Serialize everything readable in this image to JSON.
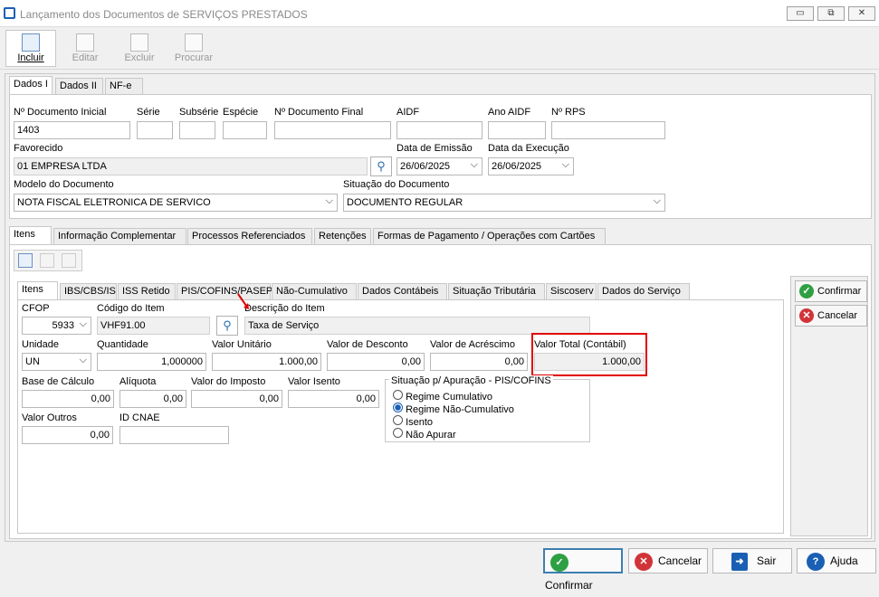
{
  "window": {
    "title": "Lançamento dos Documentos de SERVIÇOS PRESTADOS",
    "minimize": "▭",
    "restore": "⧉",
    "close": "✕"
  },
  "toolbar": {
    "incluir": "Incluir",
    "editar": "Editar",
    "excluir": "Excluir",
    "procurar": "Procurar"
  },
  "top_tabs": [
    "Dados I",
    "Dados II",
    "NF-e"
  ],
  "labels": {
    "doc_inicial": "Nº Documento Inicial",
    "serie": "Série",
    "subserie": "Subsérie",
    "especie": "Espécie",
    "doc_final": "Nº Documento Final",
    "aidf": "AIDF",
    "ano_aidf": "Ano AIDF",
    "rps": "Nº RPS",
    "favorecido": "Favorecido",
    "data_emissao": "Data de Emissão",
    "data_execucao": "Data da Execução",
    "modelo": "Modelo do Documento",
    "situacao": "Situação do Documento"
  },
  "values": {
    "doc_inicial": "1403",
    "favorecido": "01 EMPRESA LTDA",
    "data_emissao": "26/06/2025",
    "data_execucao": "26/06/2025",
    "modelo": "NOTA FISCAL ELETRONICA DE SERVICO",
    "situacao": "DOCUMENTO REGULAR"
  },
  "mid_tabs": [
    "Itens",
    "Informação Complementar",
    "Processos Referenciados",
    "Retenções",
    "Formas de Pagamento / Operações com Cartões"
  ],
  "item_tabs": [
    "Itens",
    "IBS/CBS/IS",
    "ISS Retido",
    "PIS/COFINS/PASEP",
    "Não-Cumulativo",
    "Dados Contábeis",
    "Situação Tributária",
    "Siscoserv",
    "Dados do Serviço"
  ],
  "item": {
    "cfop_label": "CFOP",
    "cfop": "5933",
    "codigo_label": "Código do Item",
    "codigo": "VHF91.00",
    "descricao_label": "Descrição do Item",
    "descricao": "Taxa de Serviço",
    "unidade_label": "Unidade",
    "unidade": "UN",
    "quantidade_label": "Quantidade",
    "quantidade": "1,000000",
    "valor_unitario_label": "Valor Unitário",
    "valor_unitario": "1.000,00",
    "valor_desconto_label": "Valor de Desconto",
    "valor_desconto": "0,00",
    "valor_acrescimo_label": "Valor de Acréscimo",
    "valor_acrescimo": "0,00",
    "valor_total_label": "Valor Total (Contábil)",
    "valor_total": "1.000,00",
    "base_calculo_label": "Base de Cálculo",
    "base_calculo": "0,00",
    "aliquota_label": "Alíquota",
    "aliquota": "0,00",
    "valor_imposto_label": "Valor do Imposto",
    "valor_imposto": "0,00",
    "valor_isento_label": "Valor Isento",
    "valor_isento": "0,00",
    "valor_outros_label": "Valor Outros",
    "valor_outros": "0,00",
    "id_cnae_label": "ID CNAE",
    "id_cnae": ""
  },
  "situacao_apuracao": {
    "title": "Situação p/ Apuração - PIS/COFINS",
    "options": [
      "Regime Cumulativo",
      "Regime Não-Cumulativo",
      "Isento",
      "Não Apurar"
    ],
    "selected": 1
  },
  "side_buttons": {
    "confirmar": "Confirmar",
    "cancelar": "Cancelar"
  },
  "bottom_buttons": {
    "confirmar": "Confirmar",
    "cancelar": "Cancelar",
    "sair": "Sair",
    "ajuda": "Ajuda"
  },
  "colors": {
    "highlight": "#e00000",
    "accent": "#1a5fb4",
    "confirm": "#2ea043",
    "cancel": "#d13438"
  }
}
